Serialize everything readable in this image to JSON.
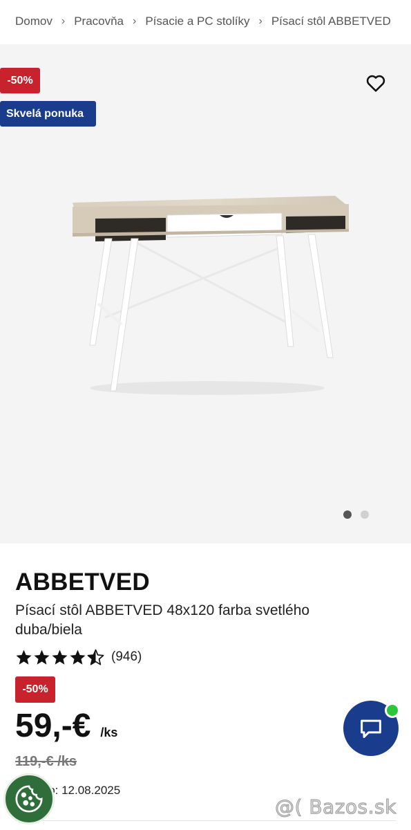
{
  "breadcrumb": {
    "items": [
      "Domov",
      "Pracovňa",
      "Písacie a PC stolíky",
      "Písací stôl ABBETVED"
    ],
    "separator": "›"
  },
  "gallery": {
    "badges": {
      "discount": "-50%",
      "deal": "Skvelá ponuka"
    },
    "wishlist_icon": "heart-outline-icon",
    "image_count": 2,
    "active_image_index": 0
  },
  "product": {
    "brand": "ABBETVED",
    "title": "Písací stôl ABBETVED 48x120 farba svetlého duba/biela",
    "rating": {
      "stars": 4.5,
      "review_count": "(946)"
    },
    "price_badge": "-50%",
    "price": "59,-€",
    "unit": "/ks",
    "old_price": "119,-€ /ks",
    "validity": "Platí do: 12.08.2025"
  },
  "chat": {
    "icon": "chat-bubble-icon",
    "status": "online"
  },
  "cookie": {
    "icon": "cookie-icon"
  },
  "watermark": "@( Bazos.sk",
  "colors": {
    "discount_red": "#c8232c",
    "brand_blue": "#1a3c8c",
    "online_green": "#2ec43c",
    "cookie_green": "#2f6e3b"
  }
}
